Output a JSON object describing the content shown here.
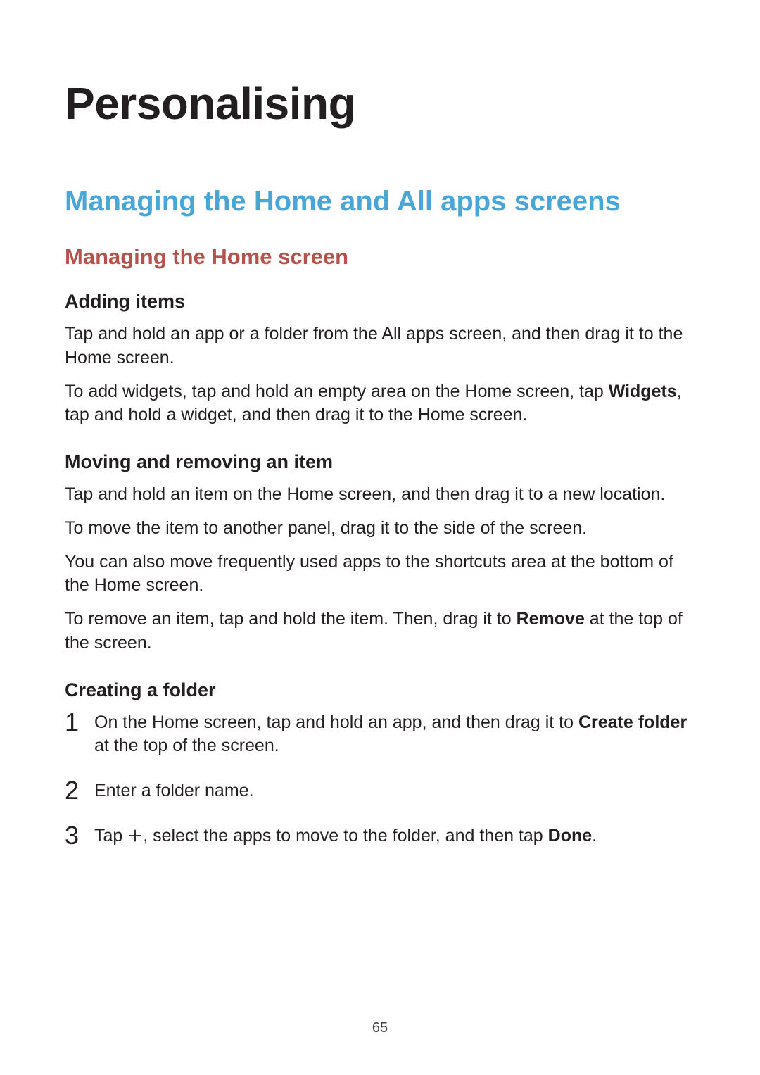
{
  "page_number": "65",
  "h1": "Personalising",
  "h2": "Managing the Home and All apps screens",
  "h3": "Managing the Home screen",
  "sections": {
    "adding": {
      "title": "Adding items",
      "p1": "Tap and hold an app or a folder from the All apps screen, and then drag it to the Home screen.",
      "p2_a": "To add widgets, tap and hold an empty area on the Home screen, tap ",
      "p2_bold": "Widgets",
      "p2_b": ", tap and hold a widget, and then drag it to the Home screen."
    },
    "moving": {
      "title": "Moving and removing an item",
      "p1": "Tap and hold an item on the Home screen, and then drag it to a new location.",
      "p2": "To move the item to another panel, drag it to the side of the screen.",
      "p3": "You can also move frequently used apps to the shortcuts area at the bottom of the Home screen.",
      "p4_a": "To remove an item, tap and hold the item. Then, drag it to ",
      "p4_bold": "Remove",
      "p4_b": " at the top of the screen."
    },
    "creating": {
      "title": "Creating a folder",
      "step1_a": "On the Home screen, tap and hold an app, and then drag it to ",
      "step1_bold": "Create folder",
      "step1_b": " at the top of the screen.",
      "step2": "Enter a folder name.",
      "step3_a": "Tap ",
      "step3_b": ", select the apps to move to the folder, and then tap ",
      "step3_bold": "Done",
      "step3_c": "."
    }
  }
}
